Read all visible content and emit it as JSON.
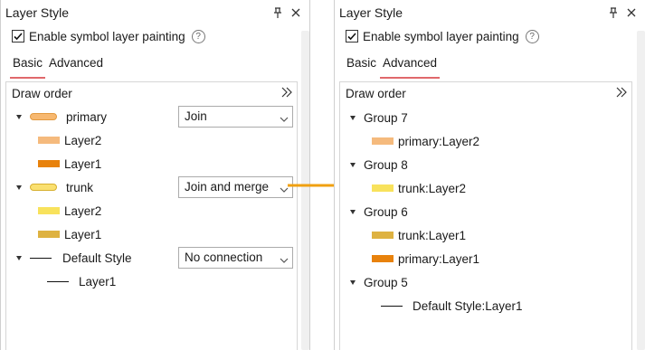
{
  "colors": {
    "primary_pill": "#f7b870",
    "trunk_pill": "#fae070",
    "swatch_light_orange": "#f5ba7d",
    "swatch_orange": "#e8820c",
    "swatch_yellow": "#f8e25c",
    "swatch_gold": "#deb241",
    "tab_underline": "#e0686b",
    "arrow": "#f0a010"
  },
  "icons": {
    "pin": "pin-icon",
    "close": "close-icon",
    "help": "help-icon",
    "expand": "double-chevron-right-icon",
    "dropdown": "chevron-down-icon",
    "collapse_node": "caret-down-icon",
    "arrow": "arrow-right-icon"
  },
  "left_panel": {
    "title": "Layer Style",
    "enable_label": "Enable symbol layer painting",
    "enable_checked": true,
    "help_glyph": "?",
    "tabs": [
      {
        "label": "Basic",
        "active": true
      },
      {
        "label": "Advanced",
        "active": false
      }
    ],
    "draw_order_label": "Draw order",
    "groups": [
      {
        "label": "primary",
        "combo_value": "Join",
        "layers": [
          "Layer2",
          "Layer1"
        ]
      },
      {
        "label": "trunk",
        "combo_value": "Join and merge",
        "layers": [
          "Layer2",
          "Layer1"
        ]
      },
      {
        "label": "Default Style",
        "combo_value": "No connection",
        "layers": [
          "Layer1"
        ]
      }
    ]
  },
  "right_panel": {
    "title": "Layer Style",
    "enable_label": "Enable symbol layer painting",
    "enable_checked": true,
    "help_glyph": "?",
    "tabs": [
      {
        "label": "Basic",
        "active": false
      },
      {
        "label": "Advanced",
        "active": true
      }
    ],
    "draw_order_label": "Draw order",
    "groups": [
      {
        "label": "Group 7",
        "items": [
          "primary:Layer2"
        ]
      },
      {
        "label": "Group 8",
        "items": [
          "trunk:Layer2"
        ]
      },
      {
        "label": "Group 6",
        "items": [
          "trunk:Layer1",
          "primary:Layer1"
        ]
      },
      {
        "label": "Group 5",
        "items": [
          "Default Style:Layer1"
        ]
      }
    ]
  }
}
